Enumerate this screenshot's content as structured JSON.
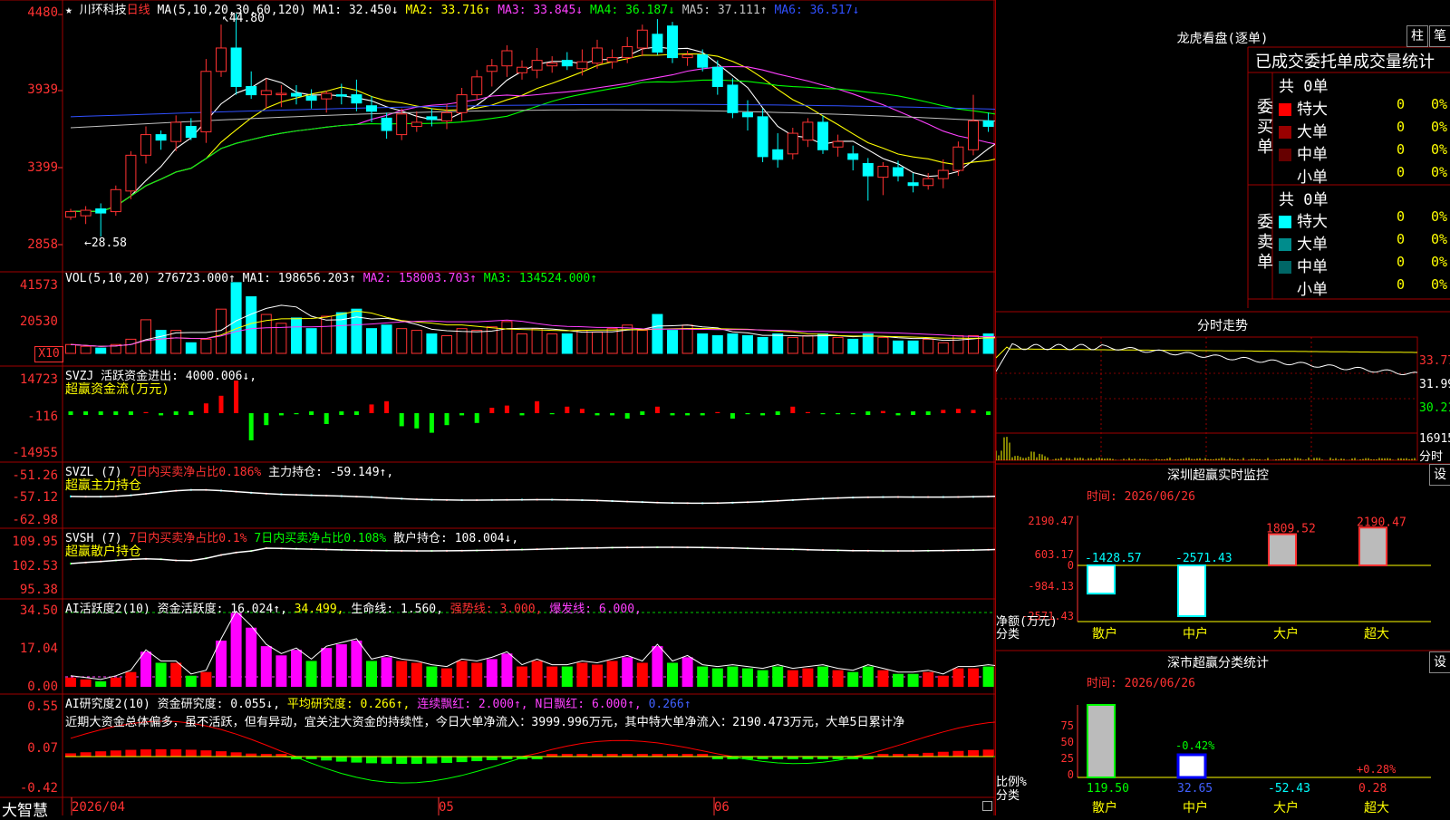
{
  "stock": {
    "name": "川环科技",
    "period": "日线",
    "star": "★"
  },
  "main_pane": {
    "ma_header": "MA(5,10,20,30,60,120)",
    "ma": [
      {
        "label": "MA1:",
        "value": "32.450↓",
        "color": "#ffffff"
      },
      {
        "label": "MA2:",
        "value": "33.716↑",
        "color": "#ffff00"
      },
      {
        "label": "MA3:",
        "value": "33.845↓",
        "color": "#ff40ff"
      },
      {
        "label": "MA4:",
        "value": "36.187↓",
        "color": "#00ff00"
      },
      {
        "label": "MA5:",
        "value": "37.111↑",
        "color": "#c0c0c0"
      },
      {
        "label": "MA6:",
        "value": "36.517↓",
        "color": "#3050ff"
      }
    ],
    "y_labels": [
      "4480",
      "3939",
      "3399",
      "2858"
    ],
    "high_label": "44.80",
    "low_label": "←28.58"
  },
  "vol_pane": {
    "header": "VOL(5,10,20)",
    "value": "276723.000↑",
    "ma": [
      {
        "text": "MA1: 198656.203↑",
        "color": "#ffffff"
      },
      {
        "text": "MA2: 158003.703↑",
        "color": "#ff40ff"
      },
      {
        "text": "MA3: 134524.000↑",
        "color": "#00ff00"
      }
    ],
    "y_labels": [
      "41573",
      "20530"
    ],
    "unit": "X10"
  },
  "svzj_pane": {
    "header": "SVZJ",
    "line1": "活跃资金进出: 4000.006↓,",
    "line2": "超赢资金流(万元)",
    "y_labels": [
      "14723",
      "-116",
      "-14955"
    ]
  },
  "svzl_pane": {
    "header": "SVZL (7)",
    "red_text": "7日内买卖净占比0.186%",
    "white_text": "主力持仓: -59.149↑,",
    "line2": "超赢主力持仓",
    "y_labels": [
      "-51.26",
      "-57.12",
      "-62.98"
    ]
  },
  "svsh_pane": {
    "header": "SVSH (7)",
    "red_text": "7日内买卖净占比0.1%",
    "green_text": "7日内买卖净占比0.108%",
    "white_text": "散户持仓: 108.004↓,",
    "line2": "超赢散户持仓",
    "y_labels": [
      "109.95",
      "102.53",
      "95.38"
    ]
  },
  "ai_pane": {
    "header": "AI活跃度2(10)",
    "items": [
      {
        "text": "资金活跃度: 16.024↑,",
        "color": "#ffffff"
      },
      {
        "text": "34.499,",
        "color": "#ffff00"
      },
      {
        "text": "生命线: 1.560,",
        "color": "#ffffff"
      },
      {
        "text": "强势线: 3.000,",
        "color": "#ff3232"
      },
      {
        "text": "爆发线: 6.000,",
        "color": "#ff40ff"
      }
    ],
    "y_labels": [
      "34.50",
      "17.04",
      "0.00"
    ]
  },
  "ai2_pane": {
    "header": "AI研究度2(10)",
    "items": [
      {
        "text": "资金研究度: 0.055↓,",
        "color": "#ffffff"
      },
      {
        "text": "平均研究度: 0.266↑,",
        "color": "#ffff00"
      },
      {
        "text": "连续飘红: 2.000↑,",
        "color": "#ff40ff"
      },
      {
        "text": "N日飘红: 6.000↑,",
        "color": "#ff40ff"
      },
      {
        "text": "0.266↑",
        "color": "#4060ff"
      }
    ],
    "comment": "近期大资金总体偏多，虽不活跃，但有异动，宜关注大资金的持续性，今日大单净流入：3999.996万元，其中特大单净流入：2190.473万元，大单5日累计净",
    "y_labels": [
      "0.55",
      "0.07",
      "-0.42"
    ]
  },
  "date_axis": {
    "brand": "大智慧",
    "labels": [
      "2026/04",
      "05",
      "06"
    ]
  },
  "dragon_tiger": {
    "title": "龙虎看盘(逐单)",
    "btn1": "柱",
    "btn2": "笔",
    "subtitle": "已成交委托单成交量统计",
    "buy": {
      "side_label": "委买单",
      "total": "共 0单",
      "rows": [
        {
          "name": "特大",
          "count": "0",
          "pct": "0%",
          "color": "#ff0000"
        },
        {
          "name": "大单",
          "count": "0",
          "pct": "0%",
          "color": "#990000"
        },
        {
          "name": "中单",
          "count": "0",
          "pct": "0%",
          "color": "#660000"
        },
        {
          "name": "小单",
          "count": "0",
          "pct": "0%",
          "color": "#000000"
        }
      ]
    },
    "sell": {
      "side_label": "委卖单",
      "total": "共 0单",
      "rows": [
        {
          "name": "特大",
          "count": "0",
          "pct": "0%",
          "color": "#00ffff"
        },
        {
          "name": "大单",
          "count": "0",
          "pct": "0%",
          "color": "#008c8c"
        },
        {
          "name": "中单",
          "count": "0",
          "pct": "0%",
          "color": "#006666"
        },
        {
          "name": "小单",
          "count": "0",
          "pct": "0%",
          "color": "#000000"
        }
      ]
    }
  },
  "intraday": {
    "title": "分时走势",
    "y_labels": [
      "33.77",
      "31.99",
      "30.21"
    ],
    "vol_label": "16915",
    "vol_unit": "分时"
  },
  "sz_monitor": {
    "title": "深圳超赢实时监控",
    "btn": "设",
    "time": "时间: 2026/06/26",
    "y_labels": [
      "2190.47",
      "603.17",
      "0",
      "-984.13",
      "-2571.43"
    ],
    "axis_label_1": "净额(万元)",
    "axis_label_2": "分类",
    "categories": [
      "散户",
      "中户",
      "大户",
      "超大"
    ],
    "values": [
      -1428.57,
      -2571.43,
      1809.52,
      2190.47
    ],
    "value_labels": [
      "-1428.57",
      "-2571.43",
      "1809.52",
      "2190.47"
    ]
  },
  "sz_class": {
    "title": "深市超赢分类统计",
    "btn": "设",
    "time": "时间: 2026/06/26",
    "y_labels": [
      "75",
      "50",
      "25",
      "0"
    ],
    "axis_label_1": "比例%",
    "axis_label_2": "分类",
    "categories": [
      "散户",
      "中户",
      "大户",
      "超大"
    ],
    "pct_labels": [
      "",
      "-0.42%",
      "",
      "+0.28%"
    ],
    "value_labels": [
      "119.50",
      "32.65",
      "-52.43",
      "0.28"
    ]
  },
  "chart_data": {
    "type": "candlestick",
    "candles": [
      [
        30.0,
        30.6,
        29.8,
        30.4
      ],
      [
        30.1,
        30.8,
        29.5,
        30.5
      ],
      [
        30.6,
        31.0,
        28.58,
        30.3
      ],
      [
        30.4,
        32.3,
        30.1,
        32.0
      ],
      [
        31.9,
        34.8,
        31.3,
        34.5
      ],
      [
        34.5,
        36.6,
        33.9,
        36.0
      ],
      [
        36.0,
        36.3,
        34.9,
        35.6
      ],
      [
        35.5,
        37.4,
        34.8,
        36.9
      ],
      [
        36.6,
        37.2,
        35.6,
        35.8
      ],
      [
        36.2,
        41.5,
        35.4,
        40.6
      ],
      [
        40.6,
        44.0,
        40.2,
        42.3
      ],
      [
        42.3,
        44.8,
        38.9,
        39.5
      ],
      [
        39.5,
        40.6,
        38.6,
        38.9
      ],
      [
        38.9,
        40.1,
        37.9,
        39.2
      ],
      [
        38.9,
        39.6,
        38.0,
        39.0
      ],
      [
        39.0,
        39.6,
        38.2,
        38.8
      ],
      [
        38.8,
        39.3,
        37.9,
        38.5
      ],
      [
        38.6,
        39.2,
        37.6,
        39.0
      ],
      [
        38.9,
        39.7,
        38.2,
        38.8
      ],
      [
        38.9,
        40.0,
        37.7,
        38.3
      ],
      [
        38.1,
        38.8,
        36.9,
        37.7
      ],
      [
        37.2,
        37.6,
        35.7,
        36.3
      ],
      [
        36.0,
        37.9,
        35.6,
        37.5
      ],
      [
        36.6,
        37.7,
        36.2,
        36.9
      ],
      [
        37.3,
        37.9,
        36.6,
        37.1
      ],
      [
        37.0,
        38.2,
        36.4,
        37.6
      ],
      [
        37.6,
        39.4,
        37.0,
        38.9
      ],
      [
        38.9,
        40.7,
        38.5,
        40.2
      ],
      [
        40.6,
        41.5,
        39.5,
        41.0
      ],
      [
        41.0,
        42.5,
        40.2,
        42.1
      ],
      [
        40.5,
        41.4,
        40.0,
        40.9
      ],
      [
        40.7,
        42.3,
        40.1,
        41.4
      ],
      [
        41.0,
        41.7,
        40.5,
        41.2
      ],
      [
        41.4,
        42.0,
        40.7,
        41.0
      ],
      [
        40.8,
        42.2,
        40.3,
        41.3
      ],
      [
        41.2,
        42.9,
        40.8,
        42.3
      ],
      [
        41.3,
        42.2,
        40.8,
        41.6
      ],
      [
        41.6,
        43.1,
        41.2,
        42.4
      ],
      [
        42.3,
        44.0,
        41.7,
        43.6
      ],
      [
        43.3,
        44.4,
        41.8,
        42.0
      ],
      [
        43.9,
        44.2,
        41.2,
        41.6
      ],
      [
        41.6,
        42.1,
        41.0,
        41.8
      ],
      [
        41.8,
        42.2,
        40.6,
        40.9
      ],
      [
        40.9,
        41.4,
        38.9,
        39.5
      ],
      [
        39.6,
        40.1,
        37.2,
        37.6
      ],
      [
        37.6,
        38.5,
        36.3,
        37.3
      ],
      [
        37.3,
        37.9,
        34.0,
        34.4
      ],
      [
        34.9,
        36.1,
        33.6,
        34.2
      ],
      [
        34.6,
        36.5,
        34.2,
        36.1
      ],
      [
        35.6,
        37.2,
        35.1,
        36.9
      ],
      [
        36.9,
        37.4,
        34.6,
        34.9
      ],
      [
        35.1,
        36.0,
        34.4,
        35.5
      ],
      [
        34.6,
        35.2,
        33.4,
        34.2
      ],
      [
        33.9,
        34.3,
        31.2,
        33.0
      ],
      [
        32.9,
        34.0,
        31.6,
        33.7
      ],
      [
        33.6,
        34.1,
        32.6,
        33.0
      ],
      [
        32.5,
        33.2,
        31.8,
        32.3
      ],
      [
        32.3,
        33.2,
        32.0,
        32.8
      ],
      [
        32.8,
        34.2,
        32.1,
        33.4
      ],
      [
        33.4,
        35.5,
        33.0,
        35.1
      ],
      [
        34.9,
        38.9,
        34.5,
        37.0
      ],
      [
        37.0,
        37.6,
        36.2,
        36.6
      ],
      [
        36.6,
        37.2,
        36.0,
        36.5
      ],
      [
        36.5,
        37.2,
        35.8,
        36.4
      ],
      [
        36.4,
        36.9,
        35.4,
        35.7
      ],
      [
        37.0,
        37.3,
        35.6,
        36.2
      ],
      [
        36.9,
        37.4,
        32.3,
        32.5
      ],
      [
        32.3,
        33.0,
        31.1,
        31.6
      ],
      [
        31.8,
        32.8,
        31.5,
        32.3
      ],
      [
        31.9,
        36.5,
        31.6,
        33.2
      ]
    ],
    "volume": [
      5,
      4,
      3,
      5,
      8,
      19,
      13,
      13,
      6,
      8,
      25,
      40,
      32,
      22,
      17,
      20,
      14,
      21,
      23,
      25,
      14,
      16,
      14,
      13,
      11,
      10,
      14,
      13,
      15,
      18,
      11,
      14,
      11,
      11,
      13,
      12,
      14,
      16,
      13,
      22,
      13,
      16,
      11,
      10,
      11,
      10,
      9,
      11,
      9,
      10,
      11,
      9,
      8,
      11,
      9,
      7,
      7,
      8,
      6,
      10,
      10,
      11,
      10,
      9,
      10,
      14,
      26,
      18,
      12,
      27
    ],
    "svzj": [
      0,
      0,
      0,
      0,
      0,
      1,
      -2,
      0,
      0,
      9,
      16,
      30,
      -25,
      -11,
      -2,
      -1,
      0,
      -10,
      0,
      0,
      8,
      11,
      -12,
      -14,
      -18,
      -11,
      -2,
      -9,
      5,
      7,
      -2,
      11,
      -1,
      6,
      4,
      -2,
      -2,
      -5,
      0,
      6,
      -2,
      -2,
      -2,
      1,
      -5,
      -1,
      -2,
      0,
      6,
      1,
      -1,
      -1,
      -1,
      0,
      2,
      -2,
      0,
      0,
      3,
      4,
      3,
      0,
      -2,
      -2,
      -2,
      -2,
      10,
      -4,
      5,
      5
    ],
    "ma_lines_colors": [
      "#ffffff",
      "#ffff00",
      "#ff40ff",
      "#00ff00",
      "#c0c0c0",
      "#3050ff"
    ]
  }
}
